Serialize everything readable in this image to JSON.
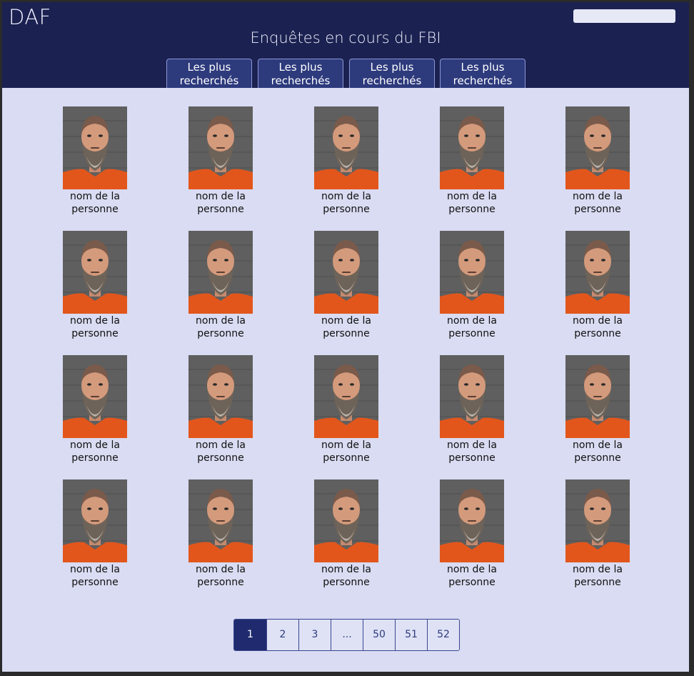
{
  "header": {
    "logo": "DAF",
    "title": "Enquêtes en cours du FBI",
    "search_placeholder": "",
    "tabs": [
      {
        "label": "Les plus\nrecherchés"
      },
      {
        "label": "Les plus\nrecherchés"
      },
      {
        "label": "Les plus\nrecherchés"
      },
      {
        "label": "Les plus\nrecherchés"
      }
    ]
  },
  "grid": {
    "people": [
      {
        "name": "nom de la\npersonne"
      },
      {
        "name": "nom de la\npersonne"
      },
      {
        "name": "nom de la\npersonne"
      },
      {
        "name": "nom de la\npersonne"
      },
      {
        "name": "nom de la\npersonne"
      },
      {
        "name": "nom de la\npersonne"
      },
      {
        "name": "nom de la\npersonne"
      },
      {
        "name": "nom de la\npersonne"
      },
      {
        "name": "nom de la\npersonne"
      },
      {
        "name": "nom de la\npersonne"
      },
      {
        "name": "nom de la\npersonne"
      },
      {
        "name": "nom de la\npersonne"
      },
      {
        "name": "nom de la\npersonne"
      },
      {
        "name": "nom de la\npersonne"
      },
      {
        "name": "nom de la\npersonne"
      },
      {
        "name": "nom de la\npersonne"
      },
      {
        "name": "nom de la\npersonne"
      },
      {
        "name": "nom de la\npersonne"
      },
      {
        "name": "nom de la\npersonne"
      },
      {
        "name": "nom de la\npersonne"
      }
    ]
  },
  "pagination": {
    "pages": [
      "1",
      "2",
      "3",
      "...",
      "50",
      "51",
      "52"
    ],
    "current": "1"
  },
  "colors": {
    "header_bg": "#1b2150",
    "content_bg": "#d9dcf2",
    "accent": "#1f2b6e"
  }
}
